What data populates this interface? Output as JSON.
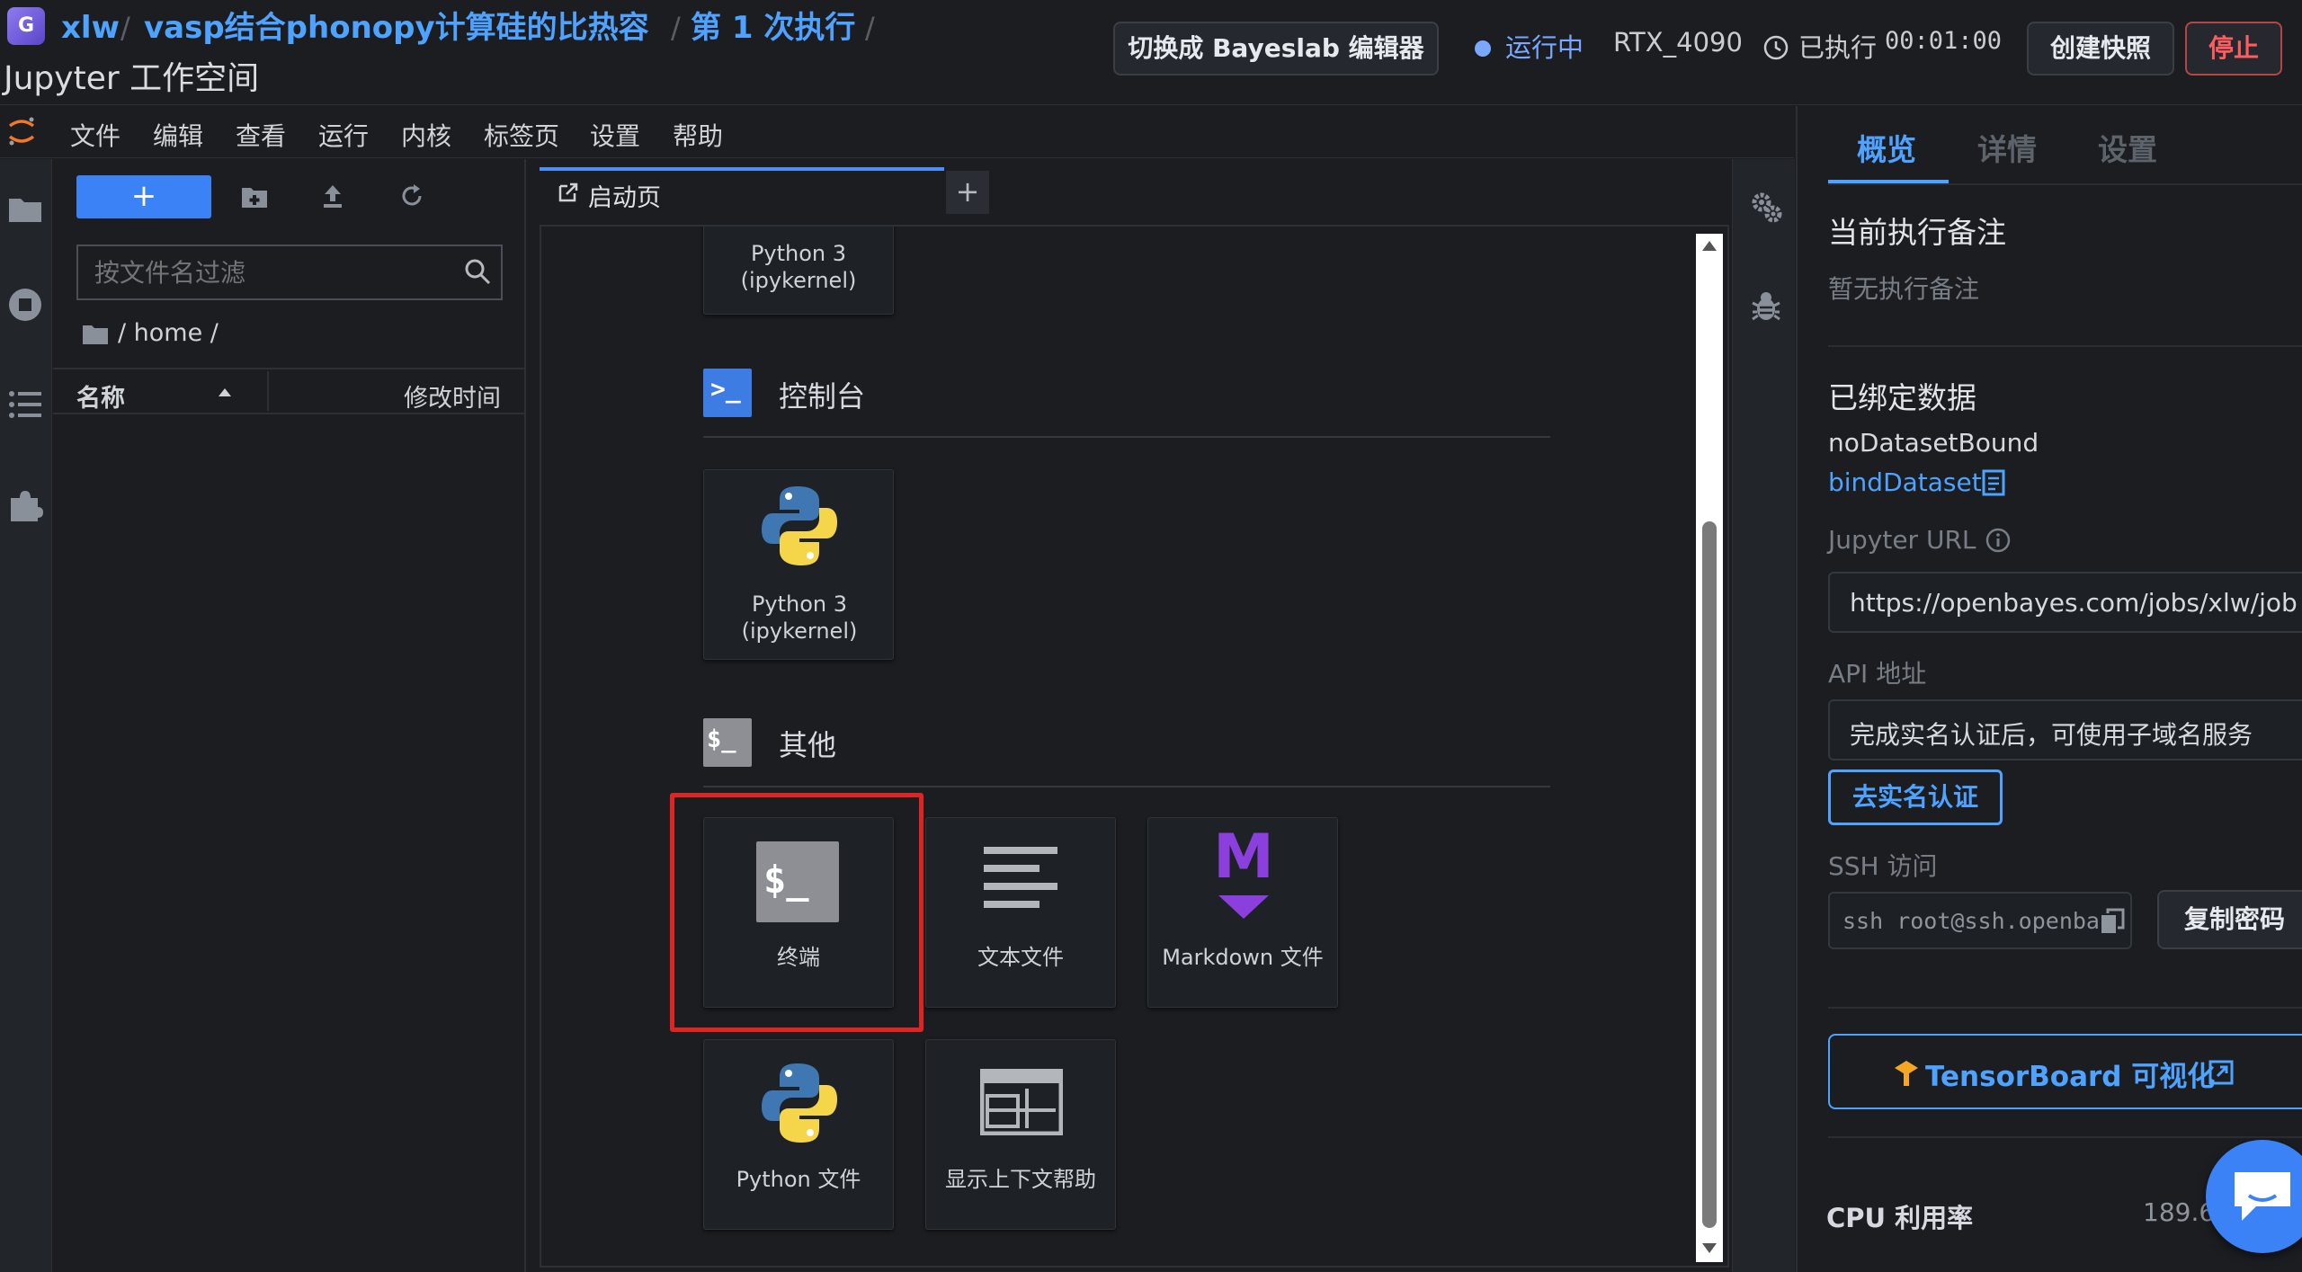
{
  "header": {
    "breadcrumb": {
      "user": "xlw",
      "project": "vasp结合phonopy计算硅的比热容",
      "run": "第 1 次执行"
    },
    "workspace_title": "Jupyter 工作空间",
    "switch_editor_label": "切换成 Bayeslab 编辑器",
    "status_label": "运行中",
    "gpu": "RTX_4090",
    "executed_prefix": "已执行",
    "executed_time": "00:01:00",
    "snapshot_label": "创建快照",
    "stop_label": "停止"
  },
  "menubar": {
    "items": [
      "文件",
      "编辑",
      "查看",
      "运行",
      "内核",
      "标签页",
      "设置",
      "帮助"
    ]
  },
  "filebrowser": {
    "new_label": "+",
    "filter_placeholder": "按文件名过滤",
    "path": "/ home /",
    "col_name": "名称",
    "col_modified": "修改时间"
  },
  "tabs": {
    "launcher_label": "启动页",
    "add_label": "+"
  },
  "launcher": {
    "notebook_card_label": "Python 3 (ipykernel)",
    "console": {
      "title": "控制台",
      "icon_text": ">_",
      "card_label": "Python 3 (ipykernel)"
    },
    "other": {
      "title": "其他",
      "icon_text": "$_",
      "cards": {
        "terminal": "终端",
        "text_file": "文本文件",
        "markdown_file": "Markdown 文件",
        "python_file": "Python 文件",
        "context_help": "显示上下文帮助"
      },
      "terminal_icon_text": "$_",
      "markdown_icon_text": "M"
    }
  },
  "panel": {
    "tabs": [
      "概览",
      "详情",
      "设置"
    ],
    "active_tab": "概览",
    "exec_note_title": "当前执行备注",
    "exec_note_empty": "暂无执行备注",
    "dataset_title": "已绑定数据",
    "dataset_none": "noDatasetBound",
    "dataset_bind": "bindDataset",
    "jupyter_url_label": "Jupyter URL",
    "jupyter_url_value": "https://openbayes.com/jobs/xlw/job",
    "api_label": "API 地址",
    "api_value": "完成实名认证后，可使用子域名服务",
    "verify_button": "去实名认证",
    "ssh_label": "SSH 访问",
    "ssh_value": "ssh root@ssh.openba",
    "copy_password": "复制密码",
    "tensorboard_label": "TensorBoard 可视化",
    "cpu_label": "CPU 利用率",
    "cpu_value": "189.6"
  },
  "colors": {
    "accent_blue": "#4da3ff",
    "primary_button": "#3b82f6",
    "stop_red": "#ff5d5d",
    "highlight_box": "#e02424",
    "markdown_purple": "#8b3fdc"
  }
}
